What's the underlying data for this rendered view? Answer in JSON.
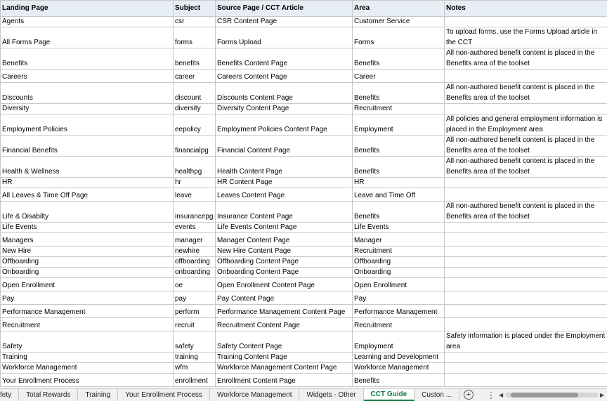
{
  "headers": [
    "Landing Page",
    "Subject",
    "Source Page / CCT Article",
    "Area",
    "Notes"
  ],
  "rows": [
    {
      "landing": "Agents",
      "subject": "csr",
      "source": "CSR Content Page",
      "area": "Customer Service",
      "notes": "",
      "size": "h1"
    },
    {
      "landing": "All Forms Page",
      "subject": "forms",
      "source": "Forms Upload",
      "area": "Forms",
      "notes": "To upload forms, use the Forms Upload article in the CCT",
      "size": "h2"
    },
    {
      "landing": "Benefits",
      "subject": "benefits",
      "source": "Benefits Content Page",
      "area": "Benefits",
      "notes": "All non-authored benefit content is placed in the Benefits area of the toolset",
      "size": "h2"
    },
    {
      "landing": "Careers",
      "subject": "career",
      "source": "Careers Content Page",
      "area": "Career",
      "notes": "",
      "size": "h3"
    },
    {
      "landing": "Discounts",
      "subject": "discount",
      "source": "Discounts Content Page",
      "area": "Benefits",
      "notes": "All non-authored benefit content is placed in the Benefits area of the toolset",
      "size": "h2"
    },
    {
      "landing": "Diversity",
      "subject": "diversity",
      "source": "Diversity Content Page",
      "area": "Recruitment",
      "notes": "",
      "size": "h1"
    },
    {
      "landing": "Employment Policies",
      "subject": "eepolicy",
      "source": "Employment Policies Content Page",
      "area": "Employment",
      "notes": "All policies and general employment information is placed in the Employment area",
      "size": "h2"
    },
    {
      "landing": "Financial Benefits",
      "subject": "financialpg",
      "source": "Financial Content Page",
      "area": "Benefits",
      "notes": "All non-authored benefit content is placed in the Benefits area of the toolset",
      "size": "h2"
    },
    {
      "landing": "Health & Wellness",
      "subject": "healthpg",
      "source": "Health Content Page",
      "area": "Benefits",
      "notes": "All non-authored benefit content is placed in the Benefits area of the toolset",
      "size": "h2"
    },
    {
      "landing": "HR",
      "subject": "hr",
      "source": "HR Content Page",
      "area": "HR",
      "notes": "",
      "size": "h1"
    },
    {
      "landing": "All Leaves & Time Off Page",
      "subject": "leave",
      "source": "Leaves Content Page",
      "area": "Leave and Time Off",
      "notes": "",
      "size": "h3"
    },
    {
      "landing": "Life & Disabilty",
      "subject": "insurancepg",
      "source": "Insurance Content Page",
      "area": "Benefits",
      "notes": "All non-authored benefit content is placed in the Benefits area of the toolset",
      "size": "h2"
    },
    {
      "landing": "Life Events",
      "subject": "events",
      "source": "Life Events Content Page",
      "area": "Life Events",
      "notes": "",
      "size": "h1"
    },
    {
      "landing": "Managers",
      "subject": "manager",
      "source": "Manager Content Page",
      "area": "Manager",
      "notes": "",
      "size": "h3"
    },
    {
      "landing": "New Hire",
      "subject": "newhire",
      "source": "New Hire Content Page",
      "area": "Recruitment",
      "notes": "",
      "size": "h1"
    },
    {
      "landing": "Offboarding",
      "subject": "offboarding",
      "source": "Offboarding Content Page",
      "area": "Offboarding",
      "notes": "",
      "size": "h1"
    },
    {
      "landing": "Onboarding",
      "subject": "onboarding",
      "source": "Onboarding Content Page",
      "area": "Onboarding",
      "notes": "",
      "size": "h1"
    },
    {
      "landing": "Open Enrollment",
      "subject": "oe",
      "source": "Open Enrollment Content Page",
      "area": "Open Enrollment",
      "notes": "",
      "size": "h3"
    },
    {
      "landing": "Pay",
      "subject": "pay",
      "source": "Pay Content Page",
      "area": "Pay",
      "notes": "",
      "size": "h3"
    },
    {
      "landing": "Performance Management",
      "subject": "perform",
      "source": "Performance Management Content Page",
      "area": "Performance Management",
      "notes": "",
      "size": "h3"
    },
    {
      "landing": "Recruitment",
      "subject": "recruit",
      "source": "Recruitment Content Page",
      "area": "Recruitment",
      "notes": "",
      "size": "h3"
    },
    {
      "landing": "Safety",
      "subject": "safety",
      "source": "Safety Content Page",
      "area": "Employment",
      "notes": "Safety information is placed under the Employment area",
      "size": "h2"
    },
    {
      "landing": "Training",
      "subject": "training",
      "source": "Training Content Page",
      "area": "Learning and Development",
      "notes": "",
      "size": "h1"
    },
    {
      "landing": "Workforce Management",
      "subject": "wfm",
      "source": "Workforce Management Content Page",
      "area": "Workforce Management",
      "notes": "",
      "size": "h1"
    },
    {
      "landing": "Your Enrollment Process",
      "subject": "enrollment",
      "source": "Enrollment Content Page",
      "area": "Benefits",
      "notes": "",
      "size": "h3"
    }
  ],
  "tabs": [
    {
      "label": "fety",
      "active": false,
      "clip": "left"
    },
    {
      "label": "Total Rewards",
      "active": false
    },
    {
      "label": "Training",
      "active": false
    },
    {
      "label": "Your Enrollment Process",
      "active": false
    },
    {
      "label": "Workforce Management",
      "active": false
    },
    {
      "label": "Widgets - Other",
      "active": false
    },
    {
      "label": "CCT Guide",
      "active": true
    },
    {
      "label": "Custon ...",
      "active": false
    }
  ],
  "tabbar_icons": {
    "add": "⊕",
    "menu": "⋮",
    "left_arrow": "◀",
    "right_arrow": "▶"
  },
  "colors": {
    "active_tab": "#107c41",
    "header_fill": "#e7edf5"
  }
}
